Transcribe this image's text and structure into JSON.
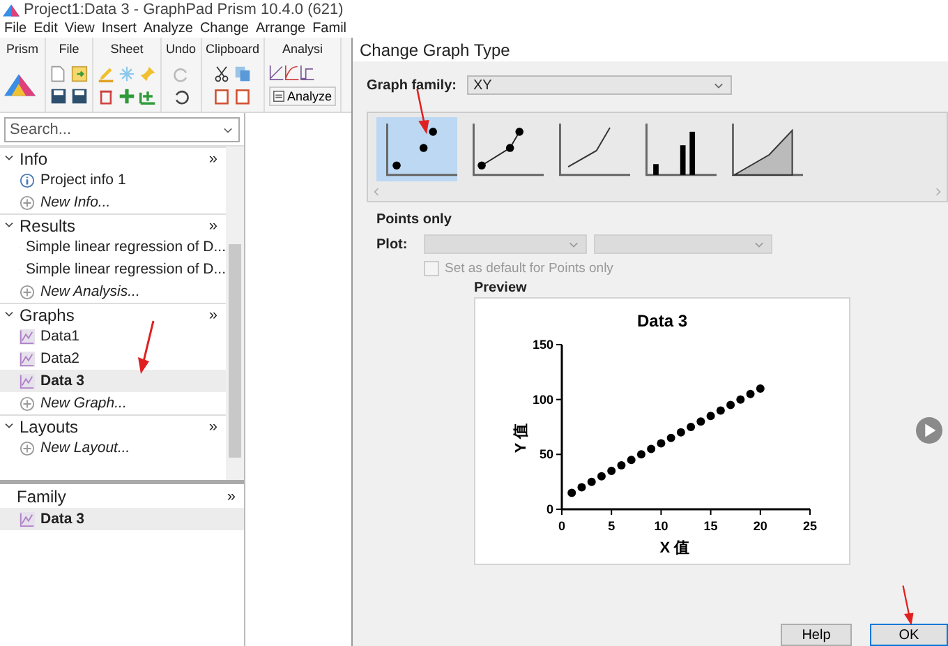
{
  "window": {
    "title": "Project1:Data 3 - GraphPad Prism 10.4.0 (621)"
  },
  "menu": [
    "File",
    "Edit",
    "View",
    "Insert",
    "Analyze",
    "Change",
    "Arrange",
    "Famil"
  ],
  "ribbon": {
    "groups": [
      {
        "label": "Prism",
        "kind": "prism"
      },
      {
        "label": "File",
        "kind": "file"
      },
      {
        "label": "Sheet",
        "kind": "sheet"
      },
      {
        "label": "Undo",
        "kind": "undo"
      },
      {
        "label": "Clipboard",
        "kind": "clipboard"
      },
      {
        "label": "Analysi",
        "kind": "analysis",
        "button": "Analyze"
      }
    ]
  },
  "navigator": {
    "search": {
      "placeholder": "Search..."
    },
    "sections": [
      {
        "title": "Info",
        "more": "»",
        "expanded": true,
        "items": [
          {
            "label": "Project info 1",
            "kind": "info",
            "selected": false
          },
          {
            "label": "New Info...",
            "kind": "new",
            "selected": false
          }
        ]
      },
      {
        "title": "Results",
        "more": "»",
        "expanded": true,
        "items": [
          {
            "label": "Simple linear regression of D...",
            "kind": "result",
            "selected": false
          },
          {
            "label": "Simple linear regression of D...",
            "kind": "result",
            "selected": false
          },
          {
            "label": "New Analysis...",
            "kind": "new",
            "selected": false
          }
        ]
      },
      {
        "title": "Graphs",
        "more": "»",
        "expanded": true,
        "items": [
          {
            "label": "Data1",
            "kind": "graph",
            "selected": false
          },
          {
            "label": "Data2",
            "kind": "graph",
            "selected": false
          },
          {
            "label": "Data 3",
            "kind": "graph",
            "selected": true
          },
          {
            "label": "New Graph...",
            "kind": "new",
            "selected": false
          }
        ]
      },
      {
        "title": "Layouts",
        "more": "»",
        "expanded": true,
        "items": [
          {
            "label": "New Layout...",
            "kind": "new",
            "selected": false
          }
        ]
      }
    ]
  },
  "family_pane": {
    "title": "Family",
    "more": "»",
    "items": [
      {
        "label": "Data 3",
        "kind": "graph",
        "selected": true
      }
    ]
  },
  "dialog": {
    "title": "Change Graph Type",
    "graph_family": {
      "label": "Graph family:",
      "value": "XY"
    },
    "gallery": [
      {
        "kind": "points",
        "selected": true
      },
      {
        "kind": "points-line",
        "selected": false
      },
      {
        "kind": "line",
        "selected": false
      },
      {
        "kind": "bar",
        "selected": false
      },
      {
        "kind": "area",
        "selected": false
      }
    ],
    "section_title": "Points only",
    "plot_label": "Plot:",
    "default_checkbox": {
      "label": "Set as default for Points only",
      "checked": false,
      "disabled": true
    },
    "preview_label": "Preview",
    "chart_data": {
      "type": "scatter",
      "title": "Data 3",
      "xlabel": "X 值",
      "ylabel": "Y 值",
      "x": [
        1,
        2,
        3,
        4,
        5,
        6,
        7,
        8,
        9,
        10,
        11,
        12,
        13,
        14,
        15,
        16,
        17,
        18,
        19,
        20
      ],
      "series": [
        {
          "color": "#000000",
          "values": [
            15,
            20,
            25,
            30,
            35,
            40,
            45,
            50,
            55,
            60,
            65,
            70,
            75,
            80,
            85,
            90,
            95,
            100,
            105,
            110
          ]
        }
      ],
      "xlim": [
        0,
        25
      ],
      "ylim": [
        0,
        150
      ],
      "xticks": [
        0,
        5,
        10,
        15,
        20,
        25
      ],
      "yticks": [
        0,
        50,
        100,
        150
      ]
    },
    "buttons": [
      {
        "label": "Help",
        "default": false
      },
      {
        "label": "OK",
        "default": true
      }
    ]
  }
}
